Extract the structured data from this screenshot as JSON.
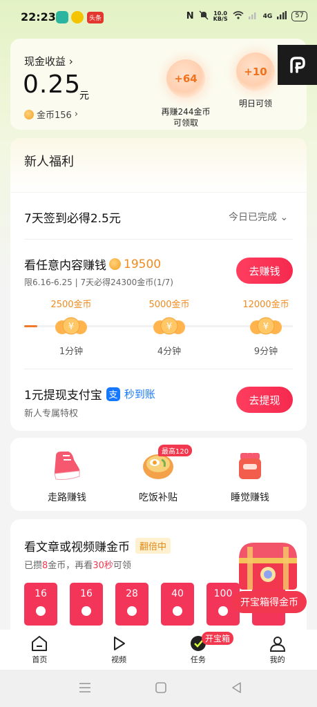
{
  "status_bar": {
    "time": "22:23",
    "net_speed_top": "10.0",
    "net_speed_bottom": "KB/S",
    "network": "4G",
    "battery": "57",
    "app_badge": "头条"
  },
  "cash_card": {
    "label": "现金收益",
    "value": "0.25",
    "unit": "元",
    "coins": "金币156",
    "bubbles": [
      {
        "value": "+64",
        "caption_line1": "再赚244金币",
        "caption_line2": "可领取"
      },
      {
        "value": "+10",
        "caption_line1": "明日可领",
        "caption_line2": ""
      }
    ]
  },
  "newbie": {
    "title": "新人福利",
    "checkin": {
      "title": "7天签到必得2.5元",
      "status": "今日已完成"
    },
    "watch": {
      "title": "看任意内容赚钱",
      "coins": "19500",
      "subtitle_range": "限6.16-6.25",
      "subtitle_goal": "7天必得24300金币(1/7)",
      "button": "去赚钱",
      "progress_fraction": 0.05,
      "milestones": [
        {
          "amount": "2500金币",
          "time": "1分钟"
        },
        {
          "amount": "5000金币",
          "time": "4分钟"
        },
        {
          "amount": "12000金币",
          "time": "9分钟"
        }
      ]
    },
    "withdraw": {
      "title": "1元提现支付宝",
      "badge": "秒到账",
      "subtitle": "新人专属特权",
      "button": "去提现"
    }
  },
  "tools": [
    {
      "label": "走路赚钱",
      "icon": "sneaker-icon"
    },
    {
      "label": "吃饭补贴",
      "icon": "food-bowl-icon",
      "badge": "最高120"
    },
    {
      "label": "睡觉赚钱",
      "icon": "sleep-icon"
    }
  ],
  "article": {
    "title": "看文章或视频赚金币",
    "tag": "翻倍中",
    "progress_prefix": "已攒",
    "progress_coins": "8",
    "progress_mid": "金币，再看",
    "progress_secs": "30秒",
    "progress_suffix": "可领",
    "envelopes": [
      "16",
      "16",
      "28",
      "40",
      "100"
    ],
    "chest_button": "开宝箱得金币"
  },
  "bottom_nav": {
    "items": [
      {
        "label": "首页",
        "icon": "home-icon"
      },
      {
        "label": "视频",
        "icon": "play-icon"
      },
      {
        "label": "任务",
        "icon": "task-icon"
      },
      {
        "label": "我的",
        "icon": "profile-icon"
      }
    ],
    "task_badge": "开宝箱"
  },
  "colors": {
    "accent": "#f2384f",
    "coin_orange": "#f08a1f",
    "bubble_text": "#f2711c"
  }
}
